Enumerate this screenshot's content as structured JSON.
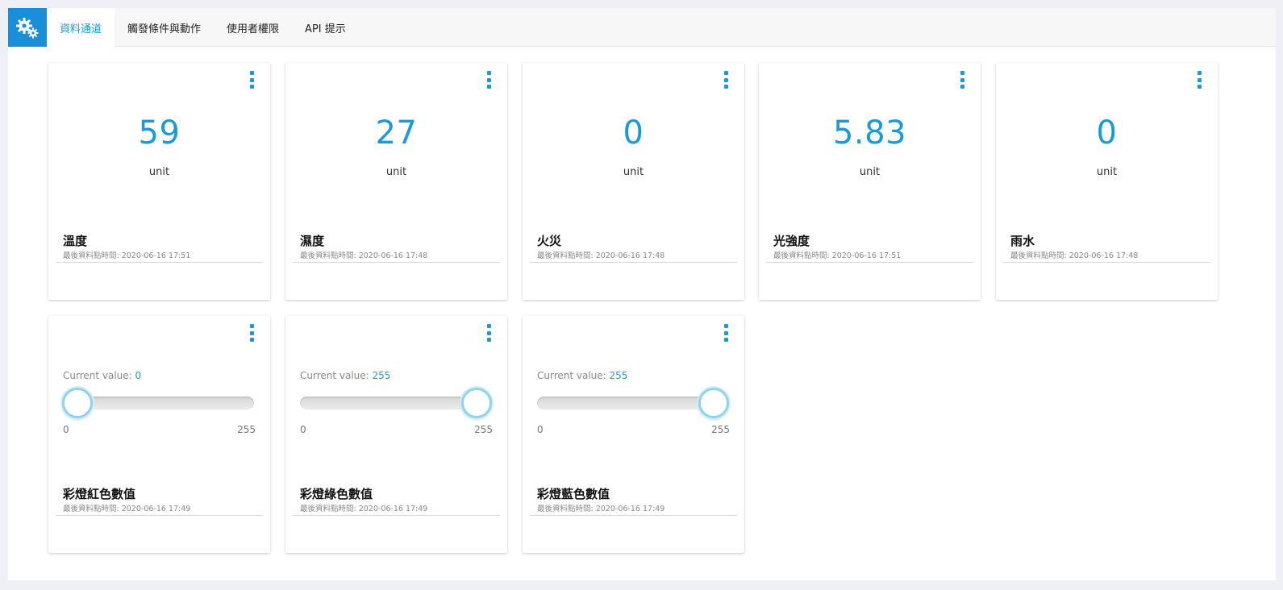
{
  "nav": {
    "tabs": [
      {
        "label": "資料通道",
        "active": true
      },
      {
        "label": "觸發條件與動作",
        "active": false
      },
      {
        "label": "使用者權限",
        "active": false
      },
      {
        "label": "API 提示",
        "active": false
      }
    ]
  },
  "sensor_cards": [
    {
      "value": "59",
      "unit": "unit",
      "title": "溫度",
      "last_time": "最後資料點時間: 2020-06-16 17:51"
    },
    {
      "value": "27",
      "unit": "unit",
      "title": "濕度",
      "last_time": "最後資料點時間: 2020-06-16 17:48"
    },
    {
      "value": "0",
      "unit": "unit",
      "title": "火災",
      "last_time": "最後資料點時間: 2020-06-16 17:48"
    },
    {
      "value": "5.83",
      "unit": "unit",
      "title": "光強度",
      "last_time": "最後資料點時間: 2020-06-16 17:51"
    },
    {
      "value": "0",
      "unit": "unit",
      "title": "雨水",
      "last_time": "最後資料點時間: 2020-06-16 17:48"
    }
  ],
  "slider_cards": [
    {
      "label": "Current value: ",
      "value": "0",
      "min": "0",
      "max": "255",
      "fraction": 0,
      "title": "彩燈紅色數值",
      "last_time": "最後資料點時間: 2020-06-16 17:49"
    },
    {
      "label": "Current value: ",
      "value": "255",
      "min": "0",
      "max": "255",
      "fraction": 1,
      "title": "彩燈綠色數值",
      "last_time": "最後資料點時間: 2020-06-16 17:49"
    },
    {
      "label": "Current value: ",
      "value": "255",
      "min": "0",
      "max": "255",
      "fraction": 1,
      "title": "彩燈藍色數值",
      "last_time": "最後資料點時間: 2020-06-16 17:49"
    }
  ],
  "icons": {
    "logo": "gears-icon",
    "card_menu": "kebab-menu-icon"
  },
  "colors": {
    "accent": "#1a9ad6",
    "logo_bg": "#1a8fd8",
    "slider_thumb_ring": "#8fd3ec"
  }
}
